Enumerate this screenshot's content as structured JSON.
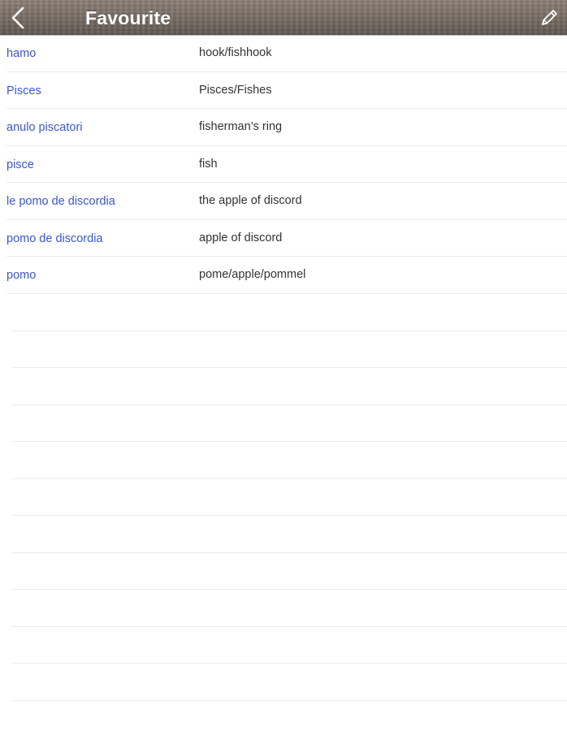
{
  "navbar": {
    "title": "Favourite",
    "back_icon": "chevron-left-icon",
    "edit_icon": "pencil-icon",
    "title_color": "#ffffff"
  },
  "favourites": [
    {
      "term": "hamo",
      "meaning": "hook/fishhook"
    },
    {
      "term": "Pisces",
      "meaning": "Pisces/Fishes"
    },
    {
      "term": "anulo piscatori",
      "meaning": "fisherman’s ring"
    },
    {
      "term": "pisce",
      "meaning": "fish"
    },
    {
      "term": "le pomo de discordia",
      "meaning": "the apple of discord"
    },
    {
      "term": "pomo de discordia",
      "meaning": "apple of discord"
    },
    {
      "term": "pomo",
      "meaning": "pome/apple/pommel"
    }
  ],
  "colors": {
    "term": "#3b55d6",
    "meaning": "#333333",
    "divider": "#ececec"
  }
}
